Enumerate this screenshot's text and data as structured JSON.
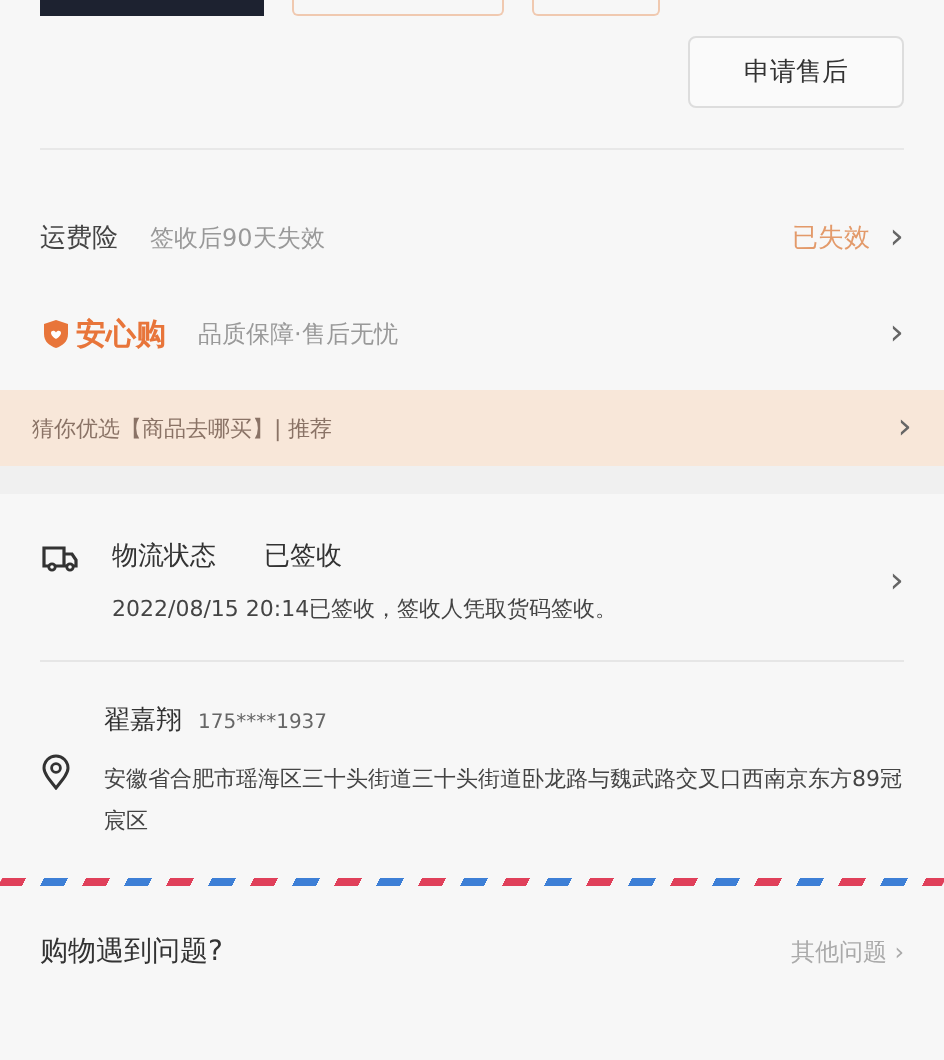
{
  "after_sale_button": "申请售后",
  "insurance": {
    "label": "运费险",
    "detail": "签收后90天失效",
    "status": "已失效",
    "chevron": "›"
  },
  "guarantee": {
    "label": "安心购",
    "detail": "品质保障·售后无忧",
    "chevron": "›"
  },
  "banner": {
    "text": "猜你优选【商品去哪买】| 推荐",
    "chevron": "›"
  },
  "logistics": {
    "label": "物流状态",
    "status": "已签收",
    "detail": "2022/08/15 20:14已签收，签收人凭取货码签收。",
    "chevron": "›"
  },
  "address": {
    "name": "翟嘉翔",
    "phone": "175****1937",
    "text": "安徽省合肥市瑶海区三十头街道三十头街道卧龙路与魏武路交叉口西南京东方89冠宸区"
  },
  "help": {
    "question": "购物遇到问题?",
    "link": "其他问题 ›"
  }
}
